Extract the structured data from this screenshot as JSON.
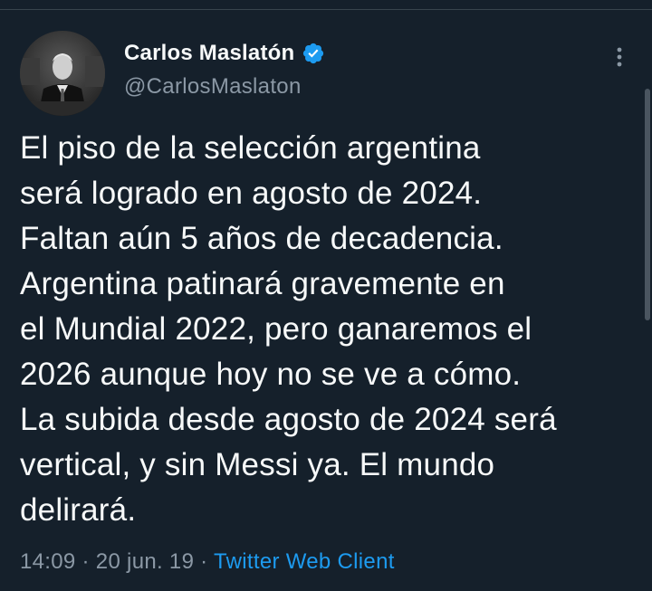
{
  "author": {
    "display_name": "Carlos Maslatón",
    "handle": "@CarlosMaslaton",
    "verified": true,
    "avatar_icon": "avatar-photo"
  },
  "tweet": {
    "text": "El piso de la selección argentina\nserá logrado en agosto de 2024.\nFaltan aún 5 años de decadencia.\nArgentina patinará gravemente en\nel Mundial 2022, pero ganaremos el\n2026 aunque hoy no se ve a cómo.\nLa subida desde agosto de 2024 será\nvertical, y sin Messi ya. El mundo\ndelirará."
  },
  "meta": {
    "time": "14:09",
    "separator": " · ",
    "date": "20 jun. 19",
    "source": "Twitter Web Client"
  },
  "colors": {
    "background": "#15202b",
    "text_primary": "#f7f9f9",
    "text_secondary": "#8b98a5",
    "accent": "#1d9bf0"
  },
  "icons": {
    "more": "more-vertical-icon",
    "verified": "verified-badge-icon"
  }
}
